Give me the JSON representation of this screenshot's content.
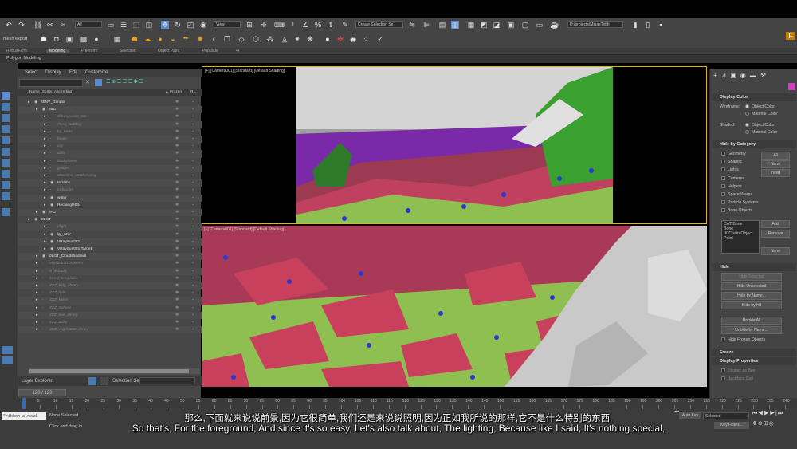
{
  "toolbar": {
    "selection_filter": "All",
    "ref_coord": "View",
    "named_selection": "Create Selection Se",
    "project_path": "D:/projects/MinasTirith",
    "workspace_label": "mesh export"
  },
  "ribbon": {
    "tabs": [
      "RebusFarm",
      "Modeling",
      "Freeform",
      "Selection",
      "Object Paint",
      "Populate"
    ],
    "sub_label": "Polygon Modeling"
  },
  "explorer": {
    "menu": [
      "Select",
      "Display",
      "Edit",
      "Customize"
    ],
    "col_name": "Name (Sorted Ascending)",
    "col_frozen": "▲ Frozen",
    "col_r": "R...",
    "rows": [
      {
        "name": "!ENV_Gondor",
        "indent": 0,
        "dim": false
      },
      {
        "name": "!BG",
        "indent": 1,
        "dim": false
      },
      {
        "name": "!librarypacks_BG",
        "indent": 2,
        "dim": true
      },
      {
        "name": "!hero_building",
        "indent": 2,
        "dim": true
      },
      {
        "name": "bg_trees",
        "indent": 2,
        "dim": true
      },
      {
        "name": "boats",
        "indent": 2,
        "dim": true
      },
      {
        "name": "city",
        "indent": 2,
        "dim": true
      },
      {
        "name": "cliffs",
        "indent": 2,
        "dim": true
      },
      {
        "name": "flockofbirds",
        "indent": 2,
        "dim": true
      },
      {
        "name": "groups",
        "indent": 2,
        "dim": true
      },
      {
        "name": "shoreline_vertdressing",
        "indent": 2,
        "dim": true
      },
      {
        "name": "terrains",
        "indent": 2,
        "dim": false
      },
      {
        "name": "trebuchet",
        "indent": 2,
        "dim": true
      },
      {
        "name": "water",
        "indent": 2,
        "dim": false
      },
      {
        "name": "Rectangle044",
        "indent": 2,
        "dim": false
      },
      {
        "name": "!FG",
        "indent": 1,
        "dim": false
      },
      {
        "name": "0LGT",
        "indent": 0,
        "dim": false
      },
      {
        "name": "0light",
        "indent": 2,
        "dim": true
      },
      {
        "name": "lgt_SKY",
        "indent": 2,
        "dim": false
      },
      {
        "name": "VRaySun001",
        "indent": 2,
        "dim": false
      },
      {
        "name": "VRaySun001.Target",
        "indent": 2,
        "dim": false
      },
      {
        "name": "0LGT_Cloudshadows",
        "indent": 1,
        "dim": false
      },
      {
        "name": "!RENDERCAMERA",
        "indent": 1,
        "dim": true
      },
      {
        "name": "0 (default)",
        "indent": 1,
        "dim": true
      },
      {
        "name": "forest_templates",
        "indent": 1,
        "dim": true
      },
      {
        "name": "ZZZ_bldg_library",
        "indent": 1,
        "dim": true
      },
      {
        "name": "ZZZ_hide",
        "indent": 1,
        "dim": true
      },
      {
        "name": "ZZZ_Moss",
        "indent": 1,
        "dim": true
      },
      {
        "name": "ZZZ_Sphere",
        "indent": 1,
        "dim": true
      },
      {
        "name": "ZZZ_tree_library",
        "indent": 1,
        "dim": true
      },
      {
        "name": "ZZZ_utility",
        "indent": 1,
        "dim": true
      },
      {
        "name": "ZZZ_vegetation_library",
        "indent": 1,
        "dim": true
      }
    ],
    "footer": "Layer Explorer",
    "selection_set": "Selection Set:",
    "frame_counter": "120 / 120"
  },
  "viewport": {
    "top_label": "[+] [Camera001] [Standard] [Default Shading]",
    "bottom_label": "[+] [Camera001] [Standard] [Default Shading]"
  },
  "cmd": {
    "display_color": "Display Color",
    "wireframe": "Wireframe:",
    "shaded": "Shaded:",
    "object_color": "Object Color",
    "material_color": "Material Color",
    "hide_by_category": "Hide by Category",
    "categories": [
      "Geometry",
      "Shapes",
      "Lights",
      "Cameras",
      "Helpers",
      "Space Warps",
      "Particle Systems",
      "Bone Objects"
    ],
    "cat_buttons": [
      "All",
      "None",
      "Invert"
    ],
    "list_items": [
      "CAT Bone",
      "Bone",
      "IK Chain Object",
      "Point"
    ],
    "list_buttons": [
      "Add",
      "Remove",
      "None"
    ],
    "hide": "Hide",
    "hide_buttons": [
      "Hide Selected",
      "Hide Unselected",
      "Hide by Name...",
      "Hide by Hit",
      "Unhide All",
      "Unhide by Name..."
    ],
    "hide_frozen": "Hide Frozen Objects",
    "freeze": "Freeze",
    "display_properties": "Display Properties",
    "dp_items": [
      "Display as Box",
      "Backface Cull"
    ]
  },
  "timeline": {
    "ticks": [
      "0",
      "5",
      "10",
      "15",
      "20",
      "25",
      "30",
      "35",
      "40",
      "45",
      "50",
      "55",
      "60",
      "65",
      "70",
      "75",
      "80",
      "85",
      "90",
      "95",
      "100",
      "105",
      "110",
      "115",
      "120",
      "125",
      "130",
      "135",
      "140",
      "145",
      "150",
      "155",
      "160",
      "165",
      "170",
      "175",
      "180",
      "185",
      "190",
      "195",
      "200",
      "205",
      "210",
      "215",
      "220",
      "225",
      "230",
      "235",
      "240"
    ]
  },
  "status": {
    "maxscript": "\"ribbon alread",
    "none_selected": "None Selected",
    "hint": "Click and drag to",
    "auto_key": "Auto Key",
    "selected": "Selected",
    "key_filters": "Key Filters..."
  },
  "subtitles": {
    "zh": "那么,下面就来说说前景,因为它很简单,我们还是来说说照明,因为正如我所说的那样,它不是什么特别的东西,",
    "en": "So that's, For the foreground, And since it's so easy, Let's also talk about, The lighting, Because like I said, It's nothing special,"
  },
  "colors": {
    "accent": "#d43cc8",
    "active_blue": "#5a8ad0",
    "viewport_border": "#e8b400"
  }
}
